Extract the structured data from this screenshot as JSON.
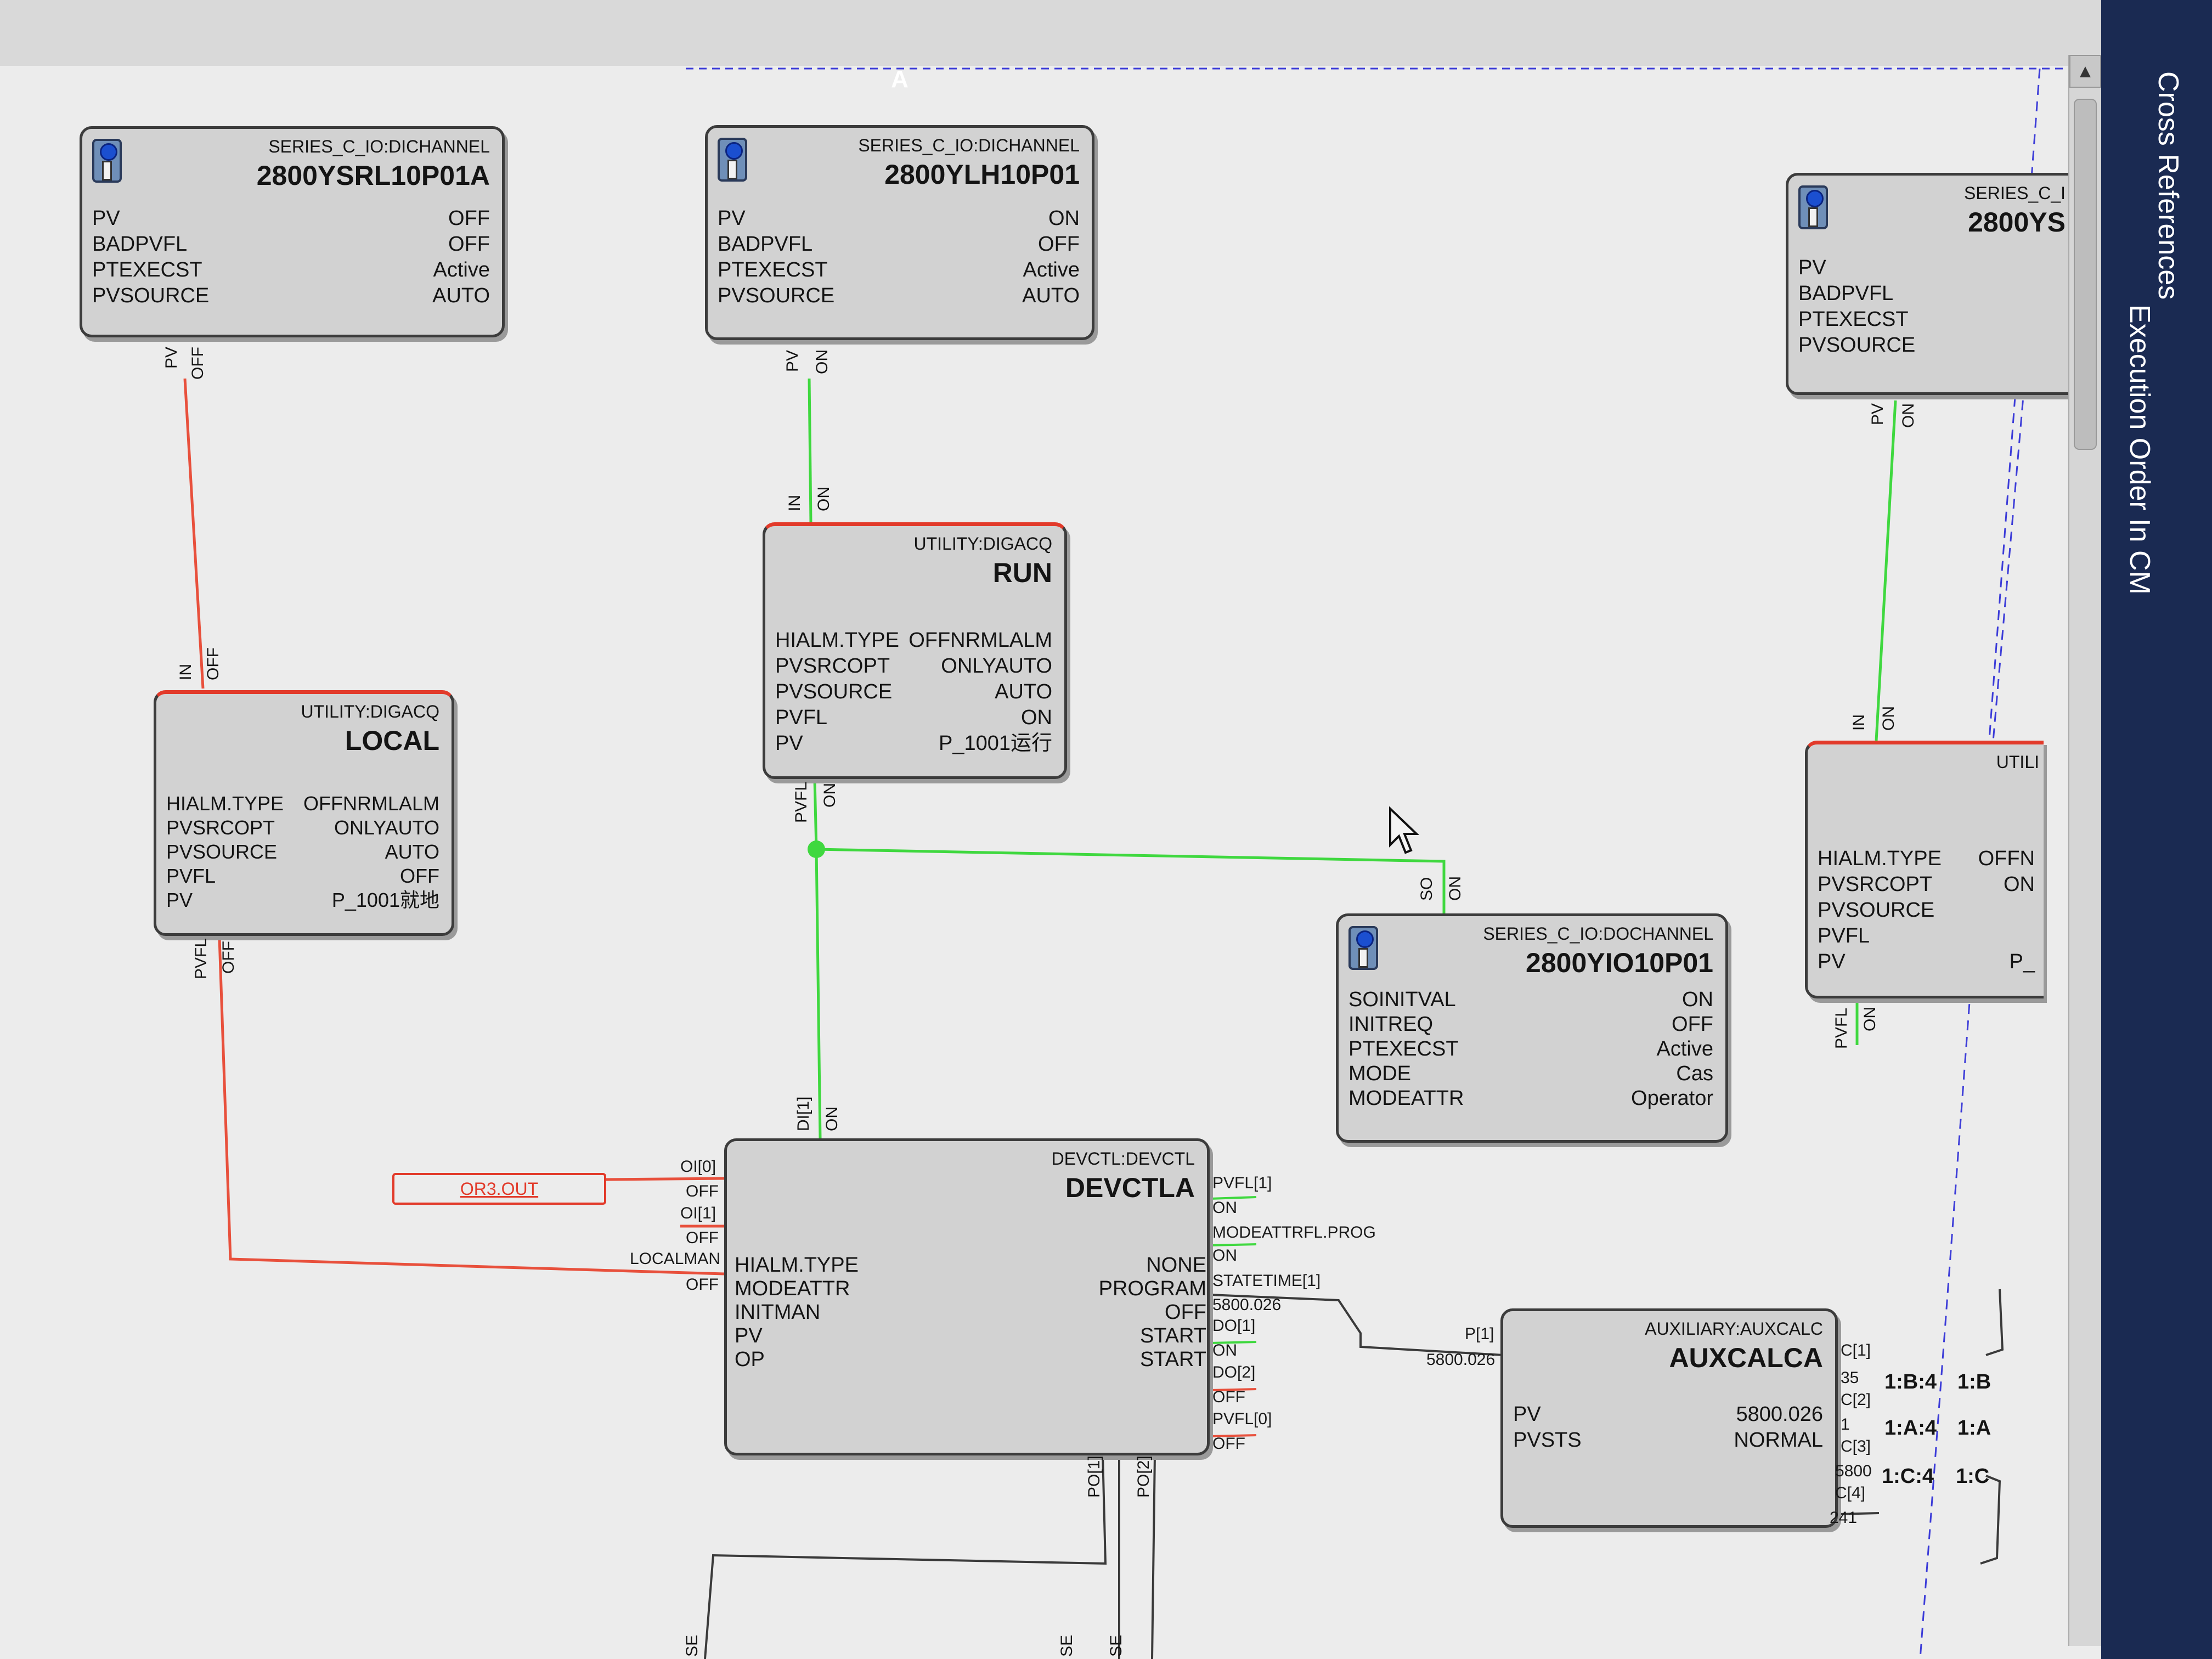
{
  "header": {
    "sheet_label": "A"
  },
  "side_tabs": [
    "Cross References",
    "Execution Order In CM"
  ],
  "blocks": {
    "b1": {
      "type": "SERIES_C_IO:DICHANNEL",
      "name": "2800YSRL10P01A",
      "rows": [
        [
          "PV",
          "OFF"
        ],
        [
          "BADPVFL",
          "OFF"
        ],
        [
          "PTEXECST",
          "Active"
        ],
        [
          "PVSOURCE",
          "AUTO"
        ]
      ]
    },
    "b2": {
      "type": "SERIES_C_IO:DICHANNEL",
      "name": "2800YLH10P01",
      "rows": [
        [
          "PV",
          "ON"
        ],
        [
          "BADPVFL",
          "OFF"
        ],
        [
          "PTEXECST",
          "Active"
        ],
        [
          "PVSOURCE",
          "AUTO"
        ]
      ]
    },
    "b3": {
      "type": "SERIES_C_I",
      "name": "2800YS",
      "rows": [
        [
          "PV",
          ""
        ],
        [
          "BADPVFL",
          ""
        ],
        [
          "PTEXECST",
          ""
        ],
        [
          "PVSOURCE",
          ""
        ]
      ]
    },
    "run": {
      "type": "UTILITY:DIGACQ",
      "name": "RUN",
      "rows": [
        [
          "HIALM.TYPE",
          "OFFNRMLALM"
        ],
        [
          "PVSRCOPT",
          "ONLYAUTO"
        ],
        [
          "PVSOURCE",
          "AUTO"
        ],
        [
          "PVFL",
          "ON"
        ],
        [
          "PV",
          "P_1001运行"
        ]
      ]
    },
    "local": {
      "type": "UTILITY:DIGACQ",
      "name": "LOCAL",
      "rows": [
        [
          "HIALM.TYPE",
          "OFFNRMLALM"
        ],
        [
          "PVSRCOPT",
          "ONLYAUTO"
        ],
        [
          "PVSOURCE",
          "AUTO"
        ],
        [
          "PVFL",
          "OFF"
        ],
        [
          "PV",
          "P_1001就地"
        ]
      ]
    },
    "util3": {
      "type": "UTILI",
      "name": "",
      "rows": [
        [
          "HIALM.TYPE",
          "OFFN"
        ],
        [
          "PVSRCOPT",
          "ON"
        ],
        [
          "PVSOURCE",
          ""
        ],
        [
          "PVFL",
          ""
        ],
        [
          "PV",
          "P_"
        ]
      ]
    },
    "doch": {
      "type": "SERIES_C_IO:DOCHANNEL",
      "name": "2800YIO10P01",
      "rows": [
        [
          "SOINITVAL",
          "ON"
        ],
        [
          "INITREQ",
          "OFF"
        ],
        [
          "PTEXECST",
          "Active"
        ],
        [
          "MODE",
          "Cas"
        ],
        [
          "MODEATTR",
          "Operator"
        ]
      ]
    },
    "devctl": {
      "type": "DEVCTL:DEVCTL",
      "name": "DEVCTLA",
      "rows": [
        [
          "HIALM.TYPE",
          "NONE"
        ],
        [
          "MODEATTR",
          "PROGRAM"
        ],
        [
          "INITMAN",
          "OFF"
        ],
        [
          "PV",
          "START"
        ],
        [
          "OP",
          "START"
        ]
      ]
    },
    "aux": {
      "type": "AUXILIARY:AUXCALC",
      "name": "AUXCALCA",
      "rows": [
        [
          "PV",
          "5800.026"
        ],
        [
          "PVSTS",
          "NORMAL"
        ]
      ]
    }
  },
  "pins": {
    "b1_out": [
      "PV",
      "OFF"
    ],
    "b2_out": [
      "PV",
      "ON"
    ],
    "b3_out": [
      "PV",
      "ON"
    ],
    "run_in": [
      "IN",
      "ON"
    ],
    "run_out": [
      "PVFL",
      "ON"
    ],
    "local_in": [
      "IN",
      "OFF"
    ],
    "local_out": [
      "PVFL",
      "OFF"
    ],
    "util3_in": [
      "IN",
      "ON"
    ],
    "util3_out": [
      "PVFL",
      "ON"
    ],
    "doch_in": [
      "SO",
      "ON"
    ],
    "dev_in": [
      "DI[1]",
      "ON"
    ],
    "dev_left": [
      "OI[0]",
      "OFF",
      "OI[1]",
      "OFF",
      "LOCALMAN",
      "OFF"
    ],
    "dev_right": [
      "PVFL[1]",
      "ON",
      "MODEATTRFL.PROG",
      "ON",
      "STATETIME[1]",
      "5800.026",
      "DO[1]",
      "ON",
      "DO[2]",
      "OFF",
      "PVFL[0]",
      "OFF"
    ],
    "dev_bottom": [
      "PO[1]",
      "PO[2]"
    ],
    "aux_in": [
      "P[1]",
      "5800.026"
    ],
    "aux_right": [
      "C[1]",
      "35",
      "C[2]",
      "1",
      "C[3]",
      "5800",
      "C[4]",
      "241"
    ],
    "bottom_stubs": [
      "SE",
      "SE",
      "SE"
    ]
  },
  "or_ref": "OR3.OUT",
  "cross_refs": [
    "1:B:4",
    "1:B",
    "1:A:4",
    "1:A",
    "1:C:4",
    "1:C"
  ],
  "colors": {
    "true_wire": "#3fd83f",
    "false_wire": "#e8503c",
    "dash_line": "#3c3cd8",
    "sidebar": "#1a2a52"
  }
}
